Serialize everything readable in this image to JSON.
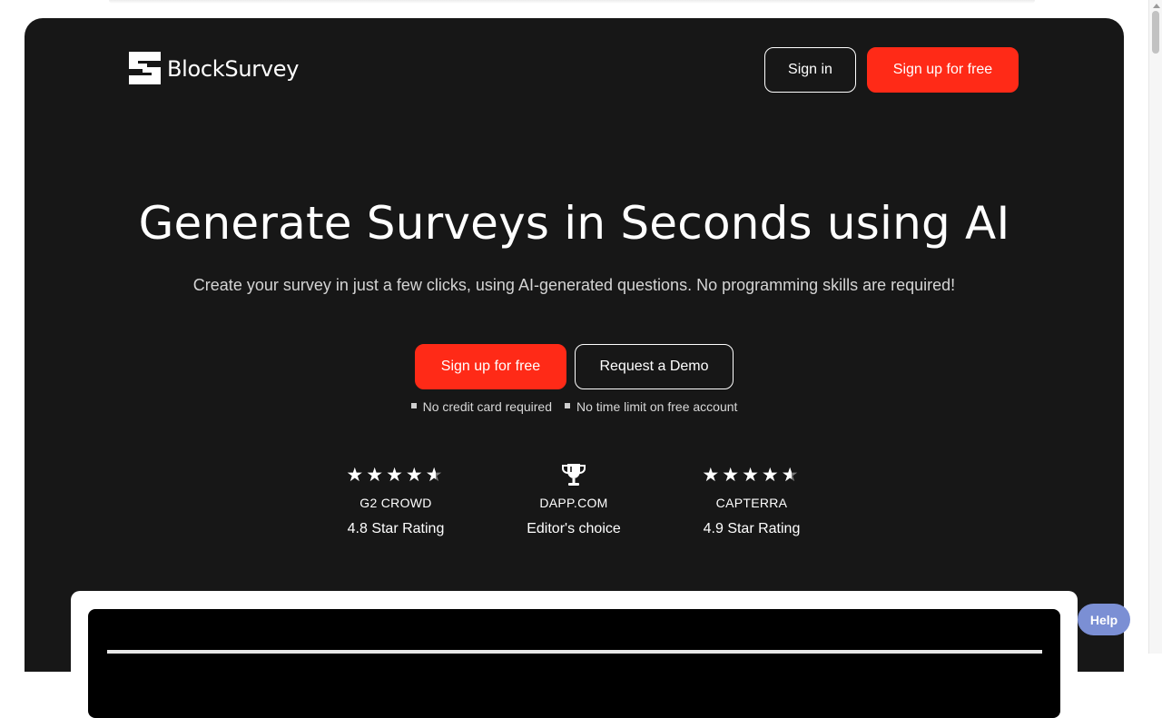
{
  "header": {
    "logo_text": "BlockSurvey",
    "signin_label": "Sign in",
    "signup_label": "Sign up for free"
  },
  "hero": {
    "title": "Generate Surveys in Seconds using AI",
    "subtitle": "Create your survey in just a few clicks, using AI-generated questions. No programming skills are required!",
    "primary_cta": "Sign up for free",
    "secondary_cta": "Request a Demo",
    "notes": [
      "No credit card required",
      "No time limit on free account"
    ]
  },
  "ratings": [
    {
      "source": "G2 CROWD",
      "text": "4.8 Star Rating",
      "stars": 4.8,
      "icon": "stars"
    },
    {
      "source": "DAPP.COM",
      "text": "Editor's choice",
      "icon": "trophy-icon"
    },
    {
      "source": "CAPTERRA",
      "text": "4.9 Star Rating",
      "stars": 4.9,
      "icon": "stars"
    }
  ],
  "help": {
    "label": "Help"
  },
  "colors": {
    "hero_background": "#171717",
    "accent": "#ff2a17",
    "help_button": "#7b8fd4"
  }
}
